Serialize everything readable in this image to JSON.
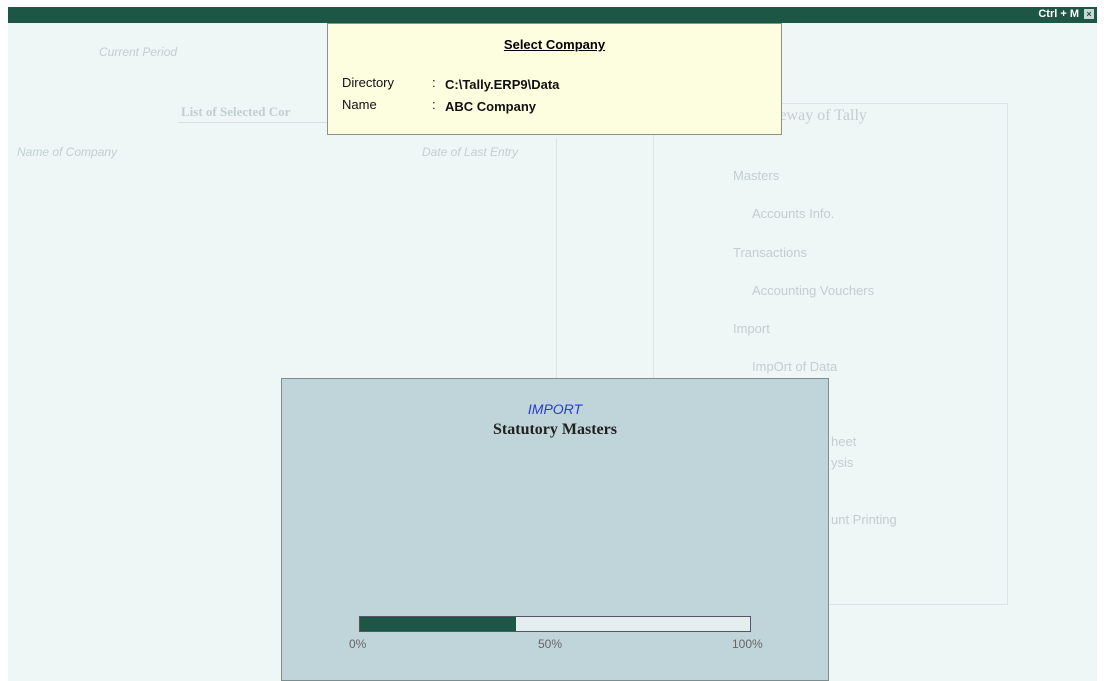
{
  "titlebar": {
    "shortcut": "Ctrl + M",
    "close_glyph": "×"
  },
  "background": {
    "current_period_label": "Current Period",
    "list_selected_label": "List of Selected Cor",
    "name_of_company_header": "Name of Company",
    "date_of_last_entry_header": "Date of Last Entry",
    "gateway_title": "teway of Tally",
    "gateway_items": [
      "Masters",
      "Accounts Info.",
      "Transactions",
      "Accounting Vouchers",
      "Import",
      "ImpOrt of Data",
      "heet",
      "ysis",
      "unt Printing"
    ]
  },
  "select_company": {
    "title": "Select Company",
    "directory_label": "Directory",
    "directory_value": "C:\\Tally.ERP9\\Data",
    "name_label": "Name",
    "name_value": "ABC Company",
    "colon": ":"
  },
  "import_dialog": {
    "kicker": "IMPORT",
    "title": "Statutory Masters",
    "progress_fraction": 0.4,
    "tick_labels": [
      "0%",
      "50%",
      "100%"
    ]
  },
  "colors": {
    "titlebar": "#1d5645",
    "workarea": "#eef6f6",
    "popup": "#fdfddf",
    "dialog": "#bfd5d9",
    "progress_fill": "#1d5645",
    "import_kicker": "#2a3bd6"
  }
}
